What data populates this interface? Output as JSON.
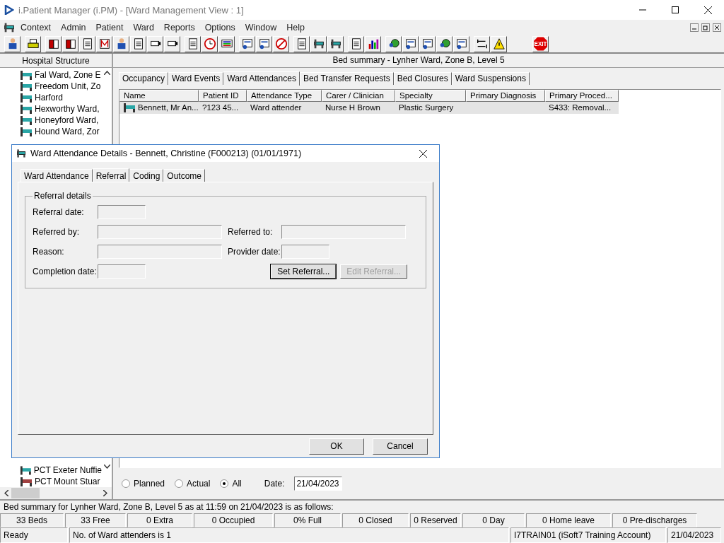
{
  "window": {
    "title": "i.Patient Manager (i.PM) - [Ward Management View : 1]"
  },
  "menu": [
    "Context",
    "Admin",
    "Patient",
    "Ward",
    "Reports",
    "Options",
    "Window",
    "Help"
  ],
  "toolbar": {
    "exit_label": "EXIT"
  },
  "sidebar": {
    "title": "Hospital Structure",
    "items": [
      {
        "label": "Fal Ward, Zone E",
        "color": "#2aa6a6"
      },
      {
        "label": "Freedom Unit, Zo",
        "color": "#2aa6a6"
      },
      {
        "label": "Harford",
        "color": "#2aa6a6"
      },
      {
        "label": "Hexworthy Ward,",
        "color": "#2aa6a6"
      },
      {
        "label": "Honeyford Ward,",
        "color": "#2aa6a6"
      },
      {
        "label": "Hound Ward, Zor",
        "color": "#2aa6a6"
      }
    ],
    "more_items": [
      {
        "label": "PCT Exeter Nuffie",
        "color": "#2aa6a6"
      },
      {
        "label": "PCT Mount Stuar",
        "color": "#a04040"
      }
    ]
  },
  "summary_title": "Bed summary - Lynher Ward, Zone B, Level 5",
  "tabs": [
    {
      "label": "Occupancy",
      "selected": false
    },
    {
      "label": "Ward Events",
      "selected": false
    },
    {
      "label": "Ward Attendances",
      "selected": true
    },
    {
      "label": "Bed Transfer Requests",
      "selected": false
    },
    {
      "label": "Bed Closures",
      "selected": false
    },
    {
      "label": "Ward Suspensions",
      "selected": false
    }
  ],
  "table": {
    "columns": [
      "Name",
      "Patient ID",
      "Attendance Type",
      "Carer / Clinician",
      "Specialty",
      "Primary Diagnosis",
      "Primary Proced..."
    ],
    "rows": [
      {
        "cells": [
          "Bennett, Mr An...",
          "?123 45...",
          "Ward attender",
          "Nurse H Brown",
          "Plastic Surgery",
          null,
          "S433: Removal..."
        ],
        "selected": true
      }
    ]
  },
  "filter": {
    "options": [
      {
        "label": "Planned",
        "selected": false
      },
      {
        "label": "Actual",
        "selected": false
      },
      {
        "label": "All",
        "selected": true
      }
    ],
    "date_label": "Date:",
    "date": "21/04/2023"
  },
  "status": {
    "summary": "Bed summary for Lynher Ward, Zone B, Level 5 as at 11:59 on 21/04/2023 is as follows:",
    "counters": [
      "33 Beds",
      "33 Free",
      "0 Extra",
      "0 Occupied",
      "0% Full",
      "0 Closed",
      "0 Reserved",
      "0 Day",
      "0 Home leave",
      "0 Pre-discharges"
    ],
    "message": "Ready",
    "detail": "No. of Ward attenders is 1",
    "user": "I7TRAIN01 (iSoft7 Training Account)",
    "date": "21/04/2023"
  },
  "dialog": {
    "title": "Ward Attendance Details - Bennett, Christine (F000213) (01/01/1971)",
    "tabs": [
      {
        "label": "Ward Attendance",
        "selected": false
      },
      {
        "label": "Referral",
        "selected": true
      },
      {
        "label": "Coding",
        "selected": false
      },
      {
        "label": "Outcome",
        "selected": false
      }
    ],
    "group": "Referral details",
    "rows": [
      [
        {
          "label": "Referral date:",
          "kind": "short",
          "disabled": true
        }
      ],
      [
        {
          "label": "Referred by:",
          "kind": "long",
          "disabled": true
        },
        {
          "label": "Referred to:",
          "kind": "long",
          "disabled": true
        }
      ],
      [
        {
          "label": "Reason:",
          "kind": "long",
          "disabled": true
        },
        {
          "label": "Provider date:",
          "kind": "short",
          "disabled": true
        }
      ],
      [
        {
          "label": "Completion date:",
          "kind": "short",
          "disabled": true
        }
      ]
    ],
    "buttons": [
      {
        "label": "Set Referral...",
        "disabled": false
      },
      {
        "label": "Edit Referral...",
        "disabled": true
      }
    ],
    "footer_buttons": [
      "OK",
      "Cancel"
    ]
  }
}
